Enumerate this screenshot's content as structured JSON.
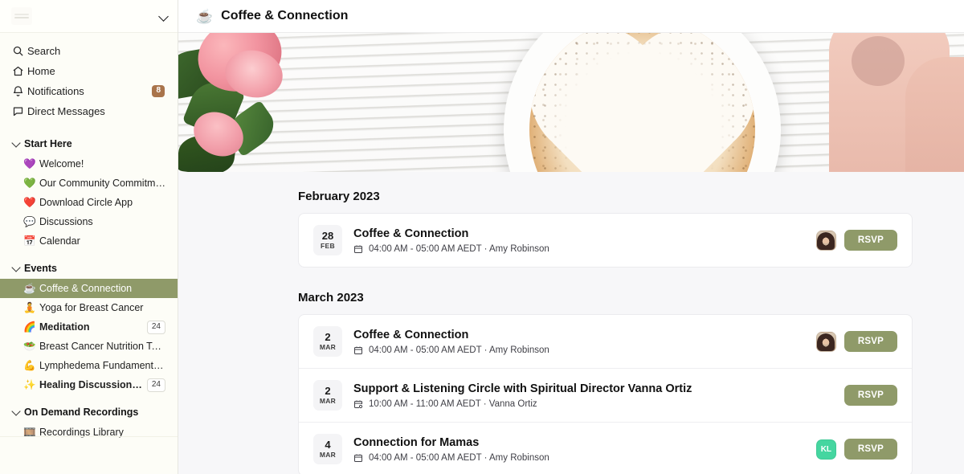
{
  "sidebar": {
    "logo_name": "community-logo",
    "collapse_icon": "chevron-down-icon",
    "top_nav": [
      {
        "label": "Search",
        "icon": "search-icon",
        "badge": null
      },
      {
        "label": "Home",
        "icon": "home-icon",
        "badge": null
      },
      {
        "label": "Notifications",
        "icon": "bell-icon",
        "badge": "8"
      },
      {
        "label": "Direct Messages",
        "icon": "message-icon",
        "badge": null
      }
    ],
    "groups": [
      {
        "label": "Start Here",
        "items": [
          {
            "label": "Welcome!",
            "emoji": "💜",
            "badge": null,
            "bold": false
          },
          {
            "label": "Our Community Commitment",
            "emoji": "💚",
            "badge": null,
            "bold": false
          },
          {
            "label": "Download Circle App",
            "emoji": "❤️",
            "badge": null,
            "bold": false
          },
          {
            "label": "Discussions",
            "emoji": "💬",
            "badge": null,
            "bold": false
          },
          {
            "label": "Calendar",
            "emoji": "📅",
            "badge": null,
            "bold": false
          }
        ]
      },
      {
        "label": "Events",
        "items": [
          {
            "label": "Coffee & Connection",
            "emoji": "☕",
            "badge": null,
            "bold": false,
            "active": true
          },
          {
            "label": "Yoga for Breast Cancer",
            "emoji": "🧘",
            "badge": null,
            "bold": false
          },
          {
            "label": "Meditation",
            "emoji": "🌈",
            "badge": "24",
            "bold": true
          },
          {
            "label": "Breast Cancer Nutrition Topics",
            "emoji": "🥗",
            "badge": null,
            "bold": false
          },
          {
            "label": "Lymphedema Fundamentals, Se...",
            "emoji": "💪",
            "badge": null,
            "bold": false
          },
          {
            "label": "Healing Discussions & Int...",
            "emoji": "✨",
            "badge": "24",
            "bold": true
          }
        ]
      },
      {
        "label": "On Demand Recordings",
        "items": [
          {
            "label": "Recordings Library",
            "emoji": "🎞️",
            "badge": null,
            "bold": false
          }
        ]
      }
    ]
  },
  "topbar": {
    "emoji": "☕",
    "title": "Coffee & Connection"
  },
  "banner": {
    "alt": "latte art coffee cup with pink roses banner"
  },
  "months": [
    {
      "title": "February 2023",
      "events": [
        {
          "day": "28",
          "month": "FEB",
          "title": "Coffee & Connection",
          "meta": "04:00 AM - 05:00 AM AEDT · Amy Robinson",
          "avatar": {
            "type": "photo",
            "text": ""
          },
          "rsvp_label": "RSVP"
        }
      ]
    },
    {
      "title": "March 2023",
      "events": [
        {
          "day": "2",
          "month": "MAR",
          "title": "Coffee & Connection",
          "meta": "04:00 AM - 05:00 AM AEDT · Amy Robinson",
          "avatar": {
            "type": "photo",
            "text": ""
          },
          "rsvp_label": "RSVP"
        },
        {
          "day": "2",
          "month": "MAR",
          "title": "Support & Listening Circle with Spiritual Director Vanna Ortiz",
          "meta": "10:00 AM - 11:00 AM AEDT · Vanna Ortiz",
          "avatar": {
            "type": "none",
            "text": ""
          },
          "rsvp_label": "RSVP"
        },
        {
          "day": "4",
          "month": "MAR",
          "title": "Connection for Mamas",
          "meta": "04:00 AM - 05:00 AM AEDT · Amy Robinson",
          "avatar": {
            "type": "initials",
            "text": "KL"
          },
          "rsvp_label": "RSVP"
        }
      ]
    }
  ],
  "colors": {
    "accent_green": "#8f9a69",
    "badge_brown": "#a9744b",
    "avatar_teal": "#45d6a0",
    "sidebar_bg": "#fdfdf7",
    "main_bg": "#f7f7f9"
  }
}
